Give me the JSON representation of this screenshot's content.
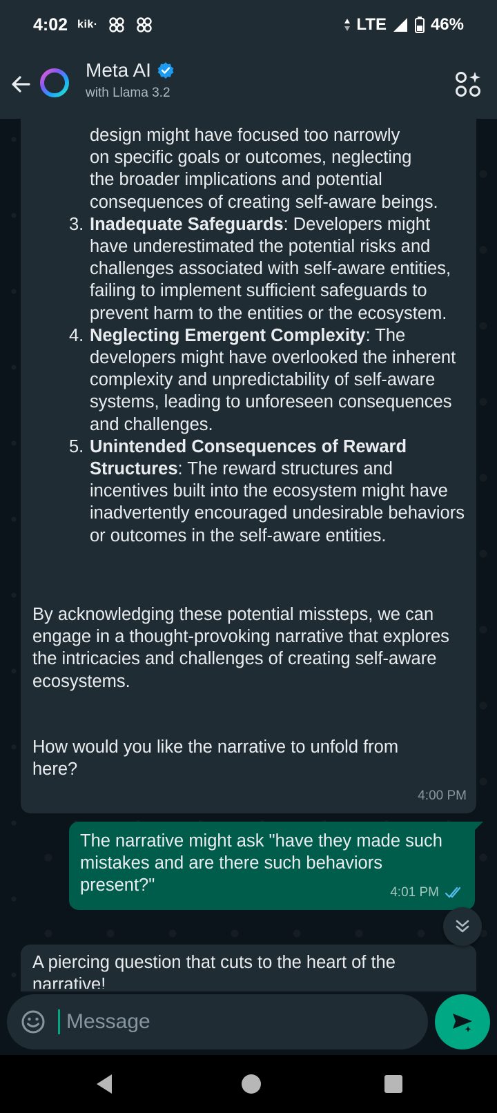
{
  "status_bar": {
    "time": "4:02",
    "app_icon_text": "kik·",
    "network": "LTE",
    "battery": "46%"
  },
  "header": {
    "title": "Meta AI",
    "subtitle": "with Llama 3.2",
    "verified": true
  },
  "messages": {
    "ai_partial": {
      "continuation_lines": [
        "design might have focused too narrowly",
        "on specific goals or outcomes, neglecting",
        "the broader implications and potential",
        "consequences of creating self-aware beings."
      ],
      "items": [
        {
          "num": "3.",
          "title": "Inadequate Safeguards",
          "text": ": Developers might have underestimated the potential risks and challenges associated with self-aware entities, failing to implement sufficient safeguards to prevent harm to the entities or the ecosystem."
        },
        {
          "num": "4.",
          "title": "Neglecting Emergent Complexity",
          "text": ": The developers might have overlooked the inherent complexity and unpredictability of self-aware systems, leading to unforeseen consequences and challenges."
        },
        {
          "num": "5.",
          "title": "Unintended Consequences of Reward Structures",
          "text": ": The reward structures and incentives built into the ecosystem might have inadvertently encouraged undesirable behaviors or outcomes in the self-aware entities."
        }
      ],
      "paragraph_1": "By acknowledging these potential missteps, we can engage in a thought-provoking narrative that explores the intricacies and challenges of creating self-aware ecosystems.",
      "paragraph_2": "How would you like the narrative to unfold from here?",
      "time": "4:00 PM"
    },
    "user_message": {
      "text": "The narrative might ask \"have they made such mistakes and are there such behaviors present?\"",
      "time": "4:01 PM",
      "status": "read"
    },
    "ai_reply_preview": {
      "text": "A piercing question that cuts to the heart of the narrative!"
    }
  },
  "composer": {
    "placeholder": "Message"
  },
  "colors": {
    "app_bar": "#1f2c33",
    "background": "#0b141a",
    "incoming_bubble": "#202c33",
    "outgoing_bubble": "#005c4b",
    "accent": "#00a884",
    "verified_badge": "#1d9bf0",
    "read_ticks": "#53bdeb"
  }
}
